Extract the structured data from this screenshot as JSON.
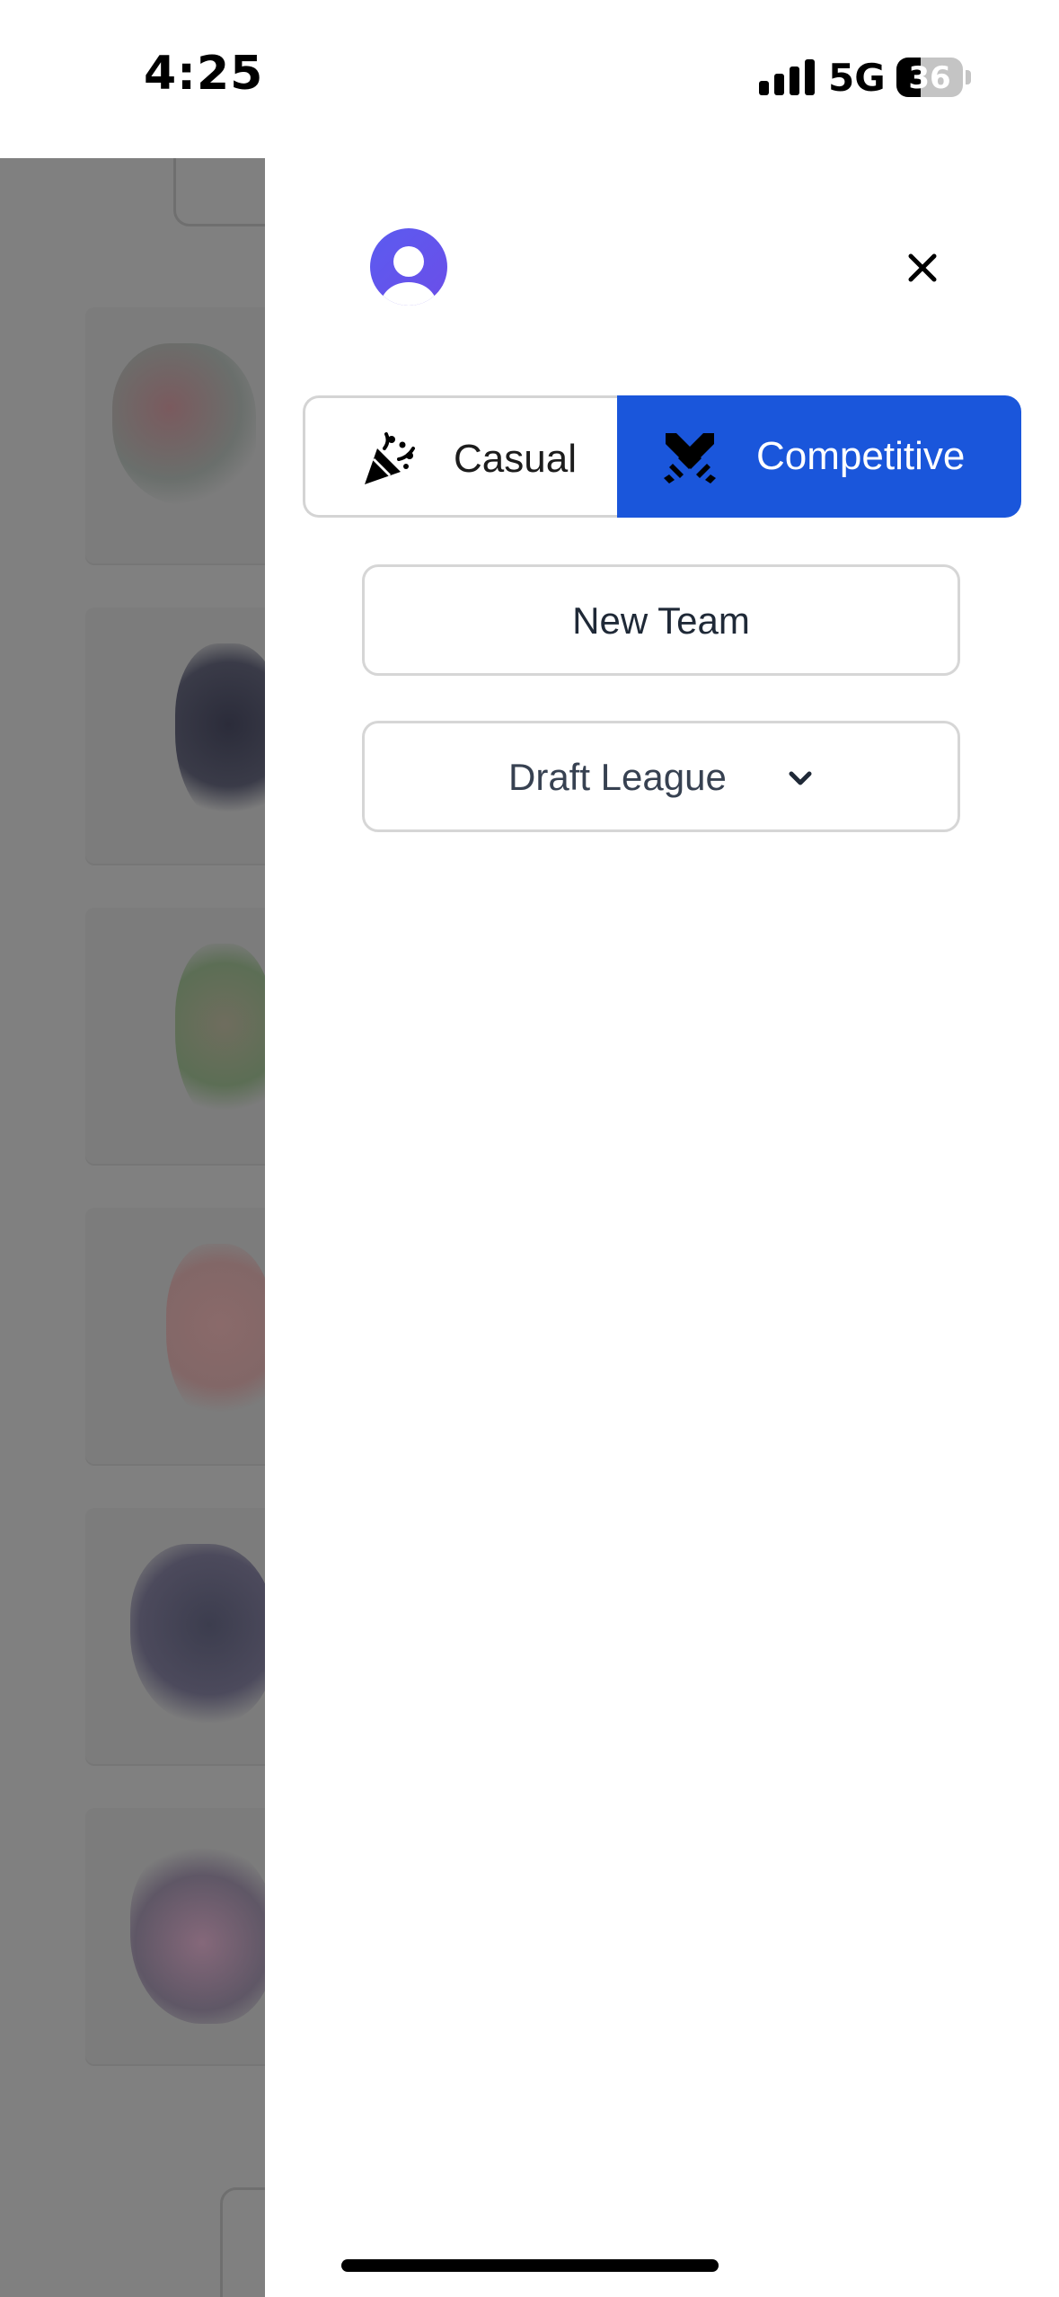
{
  "status_bar": {
    "time": "4:25",
    "network": "5G",
    "battery_level": "36",
    "signal_bars": 4
  },
  "drawer": {
    "avatar": "user-avatar-icon",
    "close": "close-icon",
    "mode_toggle": {
      "options": [
        {
          "label": "Casual",
          "icon": "party-popper-icon",
          "selected": false
        },
        {
          "label": "Competitive",
          "icon": "crossed-swords-icon",
          "selected": true
        }
      ]
    },
    "new_team_label": "New Team",
    "draft_league": {
      "label": "Draft League",
      "icon": "chevron-down-icon"
    }
  },
  "colors": {
    "accent": "#1a56db",
    "avatar": "#5b5bf0",
    "overlay": "#808080",
    "border": "#d6d6d6"
  }
}
